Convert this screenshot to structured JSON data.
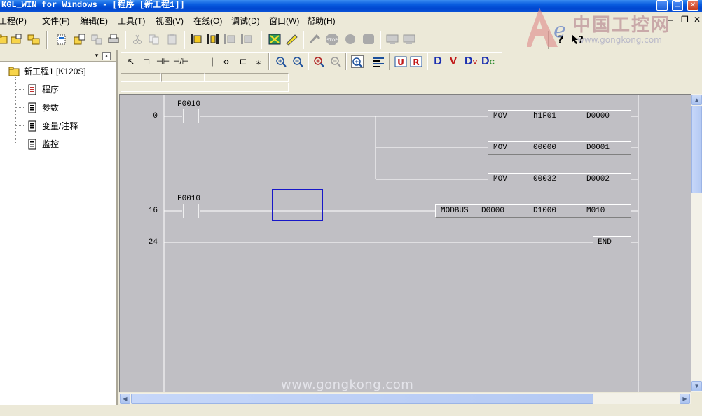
{
  "window": {
    "title": "KGL_WIN for Windows - [程序 [新工程1]]",
    "minimize": "_",
    "restore": "❐",
    "close": "✕"
  },
  "menu": {
    "items": [
      "工程(P)",
      "文件(F)",
      "编辑(E)",
      "工具(T)",
      "视图(V)",
      "在线(O)",
      "调试(D)",
      "窗口(W)",
      "帮助(H)"
    ],
    "doc_minimize": "–",
    "doc_restore": "❐",
    "doc_close": "✕"
  },
  "watermark": {
    "logo_text": "中国工控网",
    "logo_url": "www.gongkong.com",
    "canvas_text": "www.gongkong.com"
  },
  "toolbar": {
    "icons": [
      "open-project-icon",
      "open-folder-icon",
      "save-icon",
      "new-file-icon",
      "copy-file-icon",
      "export-icon",
      "print-icon",
      "cut-icon",
      "copy-icon",
      "paste-icon",
      "ladder-insert-icon",
      "ladder-row-icon",
      "ladder-col-icon",
      "ladder-del-icon",
      "compile-icon",
      "write-icon",
      "run-icon",
      "stop-icon",
      "monitor-icon",
      "force-icon",
      "upload-icon",
      "download-icon",
      "help-icon",
      "context-help-icon"
    ]
  },
  "tree": {
    "panel_close": "×",
    "panel_pin": "▾",
    "root_label": "新工程1 [K120S]",
    "children": [
      {
        "label": "程序",
        "icon": "program-doc-icon"
      },
      {
        "label": "参数",
        "icon": "param-doc-icon"
      },
      {
        "label": "变量/注释",
        "icon": "variable-doc-icon"
      },
      {
        "label": "监控",
        "icon": "monitor-doc-icon"
      }
    ]
  },
  "ladder_toolbar": {
    "select": "↖",
    "box": "□",
    "no_contact": "⊣⊢",
    "nc_contact": "⊣/⊢",
    "hline": "—",
    "vline": "|",
    "coil": "‹›",
    "func": "⊏",
    "special": "⁎",
    "D": "D",
    "V": "V",
    "Dv": "D",
    "Dc": "D",
    "Dv_sub": "V",
    "Dc_sub": "C"
  },
  "ladder": {
    "steps": [
      "0",
      "16",
      "24"
    ],
    "contacts": [
      "F0010",
      "F0010"
    ],
    "functions": [
      {
        "op": "MOV",
        "a": "h1F01",
        "b": "D0000"
      },
      {
        "op": "MOV",
        "a": "00000",
        "b": "D0001"
      },
      {
        "op": "MOV",
        "a": "00032",
        "b": "D0002"
      },
      {
        "op": "MODBUS",
        "a": "D0000",
        "b": "D1000",
        "c": "M010"
      }
    ],
    "end_label": "END"
  },
  "colors": {
    "canvas_bg": "#c0bfc4",
    "cursor": "#1717c8",
    "title_bar": "#0a5ee0"
  }
}
